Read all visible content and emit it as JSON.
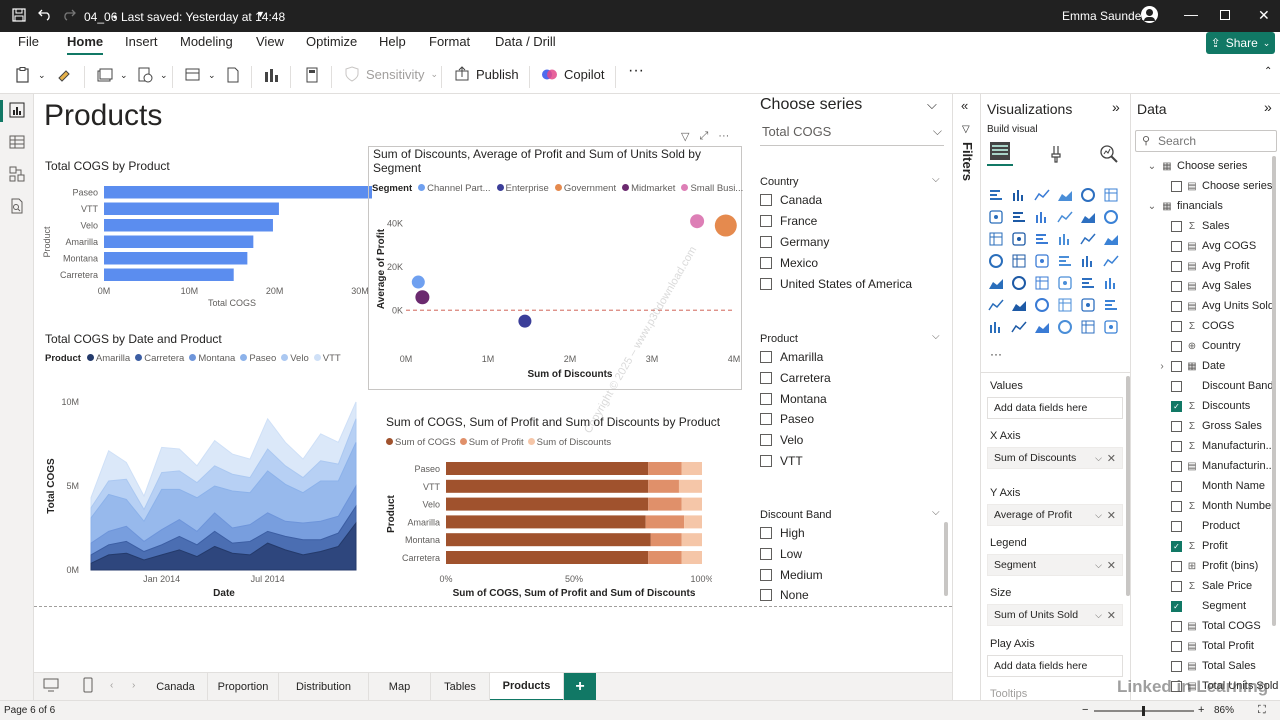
{
  "titlebar": {
    "file_name": "04_06",
    "saved": "Last saved: Yesterday at 14:48",
    "user": "Emma Saunders"
  },
  "ribbon": {
    "menus": [
      "File",
      "Home",
      "Insert",
      "Modeling",
      "View",
      "Optimize",
      "Help",
      "Format",
      "Data / Drill"
    ],
    "share": "Share",
    "sensitivity": "Sensitivity",
    "publish": "Publish",
    "copilot": "Copilot"
  },
  "page": {
    "title": "Products"
  },
  "charts": {
    "cogs_by_product": {
      "title": "Total COGS by Product",
      "chart_data": {
        "type": "bar",
        "categories": [
          "Paseo",
          "VTT",
          "Velo",
          "Amarilla",
          "Montana",
          "Carretera"
        ],
        "values": [
          33.0,
          20.5,
          19.8,
          17.5,
          16.8,
          15.2
        ],
        "xlabel": "Total COGS",
        "ylabel": "Product",
        "xticks": [
          "0M",
          "10M",
          "20M",
          "30M"
        ],
        "xlim": [
          0,
          30
        ]
      }
    },
    "scatter": {
      "title": "Sum of Discounts, Average of Profit and Sum of Units Sold by Segment",
      "legend_label": "Segment",
      "chart_data": {
        "type": "scatter",
        "series": [
          {
            "name": "Channel Part...",
            "x": 0.15,
            "y": 13000,
            "color": "#6fa0f0"
          },
          {
            "name": "Enterprise",
            "x": 1.45,
            "y": -5000,
            "color": "#3b3e99"
          },
          {
            "name": "Government",
            "x": 3.9,
            "y": 39000,
            "color": "#e58a4e"
          },
          {
            "name": "Midmarket",
            "x": 0.2,
            "y": 6000,
            "color": "#6b2a6f"
          },
          {
            "name": "Small Busi...",
            "x": 3.55,
            "y": 41000,
            "color": "#dd7fb6"
          }
        ],
        "xlabel": "Sum of Discounts",
        "ylabel": "Average of Profit",
        "xticks": [
          "0M",
          "1M",
          "2M",
          "3M",
          "4M"
        ],
        "yticks": [
          "0K",
          "20K",
          "40K"
        ],
        "xlim": [
          0,
          4
        ],
        "ylim": [
          -10000,
          48000
        ]
      }
    },
    "area": {
      "title": "Total COGS by Date and Product",
      "legend_label": "Product",
      "legend": [
        {
          "name": "Amarilla",
          "color": "#243a6b"
        },
        {
          "name": "Carretera",
          "color": "#3c5ea3"
        },
        {
          "name": "Montana",
          "color": "#6e95da"
        },
        {
          "name": "Paseo",
          "color": "#8cb2ea"
        },
        {
          "name": "Velo",
          "color": "#abc8f1"
        },
        {
          "name": "VTT",
          "color": "#cfe0f7"
        }
      ],
      "chart_data": {
        "type": "area",
        "x": [
          "Sep 2013",
          "Oct 2013",
          "Nov 2013",
          "Dec 2013",
          "Jan 2014",
          "Feb 2014",
          "Mar 2014",
          "Apr 2014",
          "May 2014",
          "Jun 2014",
          "Jul 2014",
          "Aug 2014",
          "Sep 2014",
          "Oct 2014",
          "Nov 2014",
          "Dec 2014"
        ],
        "series": [
          {
            "name": "Amarilla",
            "values": [
              0.4,
              0.9,
              1.0,
              0.6,
              0.9,
              1.2,
              0.8,
              1.4,
              1.0,
              0.9,
              1.6,
              1.2,
              0.9,
              1.1,
              1.4,
              2.8
            ]
          },
          {
            "name": "Carretera",
            "values": [
              0.5,
              0.6,
              0.7,
              0.5,
              0.6,
              0.8,
              0.7,
              0.9,
              0.6,
              0.8,
              0.7,
              0.8,
              0.9,
              0.7,
              0.8,
              1.0
            ]
          },
          {
            "name": "Montana",
            "values": [
              0.7,
              0.8,
              0.9,
              0.6,
              0.9,
              1.0,
              0.8,
              1.1,
              0.9,
              1.0,
              1.1,
              0.9,
              1.0,
              1.1,
              1.0,
              1.2
            ]
          },
          {
            "name": "Paseo",
            "values": [
              1.5,
              2.2,
              1.6,
              1.2,
              2.4,
              1.8,
              2.0,
              1.6,
              2.2,
              1.9,
              2.5,
              2.2,
              1.8,
              2.4,
              2.1,
              2.6
            ]
          },
          {
            "name": "Velo",
            "values": [
              0.6,
              0.8,
              1.2,
              0.7,
              1.0,
              1.1,
              0.9,
              1.2,
              1.0,
              0.9,
              1.3,
              1.1,
              0.9,
              1.2,
              1.0,
              1.4
            ]
          },
          {
            "name": "VTT",
            "values": [
              0.6,
              1.8,
              1.0,
              0.8,
              1.5,
              1.3,
              1.0,
              1.5,
              1.2,
              1.1,
              1.8,
              1.4,
              1.1,
              1.6,
              1.3,
              1.0
            ]
          }
        ],
        "xlabel": "Date",
        "ylabel": "Total COGS",
        "xticks": [
          "Jan 2014",
          "Jul 2014"
        ],
        "yticks": [
          "0M",
          "5M",
          "10M"
        ],
        "ylim": [
          0,
          10
        ]
      }
    },
    "stacked": {
      "title": "Sum of COGS, Sum of Profit and Sum of Discounts by Product",
      "legend": [
        {
          "name": "Sum of COGS",
          "color": "#a0522d"
        },
        {
          "name": "Sum of Profit",
          "color": "#e0906a"
        },
        {
          "name": "Sum of Discounts",
          "color": "#f5c6a8"
        }
      ],
      "chart_data": {
        "type": "bar",
        "stacked_100": true,
        "categories": [
          "Paseo",
          "VTT",
          "Velo",
          "Amarilla",
          "Montana",
          "Carretera"
        ],
        "series": [
          {
            "name": "Sum of COGS",
            "values": [
              79,
              79,
              79,
              78,
              80,
              79
            ]
          },
          {
            "name": "Sum of Profit",
            "values": [
              13,
              12,
              13,
              15,
              12,
              13
            ]
          },
          {
            "name": "Sum of Discounts",
            "values": [
              8,
              9,
              8,
              7,
              8,
              8
            ]
          }
        ],
        "xlabel": "Sum of COGS, Sum of Profit and Sum of Discounts",
        "ylabel": "Product",
        "xticks": [
          "0%",
          "50%",
          "100%"
        ]
      }
    }
  },
  "slicers": {
    "series_title": "Choose series",
    "series_value": "Total COGS",
    "country": {
      "header": "Country",
      "items": [
        "Canada",
        "France",
        "Germany",
        "Mexico",
        "United States of America"
      ]
    },
    "product": {
      "header": "Product",
      "items": [
        "Amarilla",
        "Carretera",
        "Montana",
        "Paseo",
        "Velo",
        "VTT"
      ]
    },
    "discount": {
      "header": "Discount Band",
      "items": [
        "High",
        "Low",
        "Medium",
        "None"
      ]
    }
  },
  "filters": {
    "label": "Filters"
  },
  "visualizations": {
    "title": "Visualizations",
    "build_label": "Build visual",
    "wells": [
      {
        "header": "Values",
        "value": "Add data fields here",
        "filled": false
      },
      {
        "header": "X Axis",
        "value": "Sum of Discounts",
        "filled": true
      },
      {
        "header": "Y Axis",
        "value": "Average of Profit",
        "filled": true
      },
      {
        "header": "Legend",
        "value": "Segment",
        "filled": true
      },
      {
        "header": "Size",
        "value": "Sum of Units Sold",
        "filled": true
      },
      {
        "header": "Play Axis",
        "value": "Add data fields here",
        "filled": false
      }
    ],
    "tooltips_header": "Tooltips"
  },
  "data_pane": {
    "title": "Data",
    "search_placeholder": "Search",
    "items": [
      {
        "label": "Choose series",
        "icon": "table",
        "indent": 0,
        "checked": false,
        "group": true
      },
      {
        "label": "Choose series",
        "icon": "table-field",
        "indent": 1,
        "checked": false
      },
      {
        "label": "financials",
        "icon": "table",
        "indent": 0,
        "checked": false,
        "group": true
      },
      {
        "label": "Sales",
        "icon": "sigma",
        "indent": 1,
        "checked": false
      },
      {
        "label": "Avg COGS",
        "icon": "calc",
        "indent": 1,
        "checked": false
      },
      {
        "label": "Avg Profit",
        "icon": "calc",
        "indent": 1,
        "checked": false
      },
      {
        "label": "Avg Sales",
        "icon": "calc",
        "indent": 1,
        "checked": false
      },
      {
        "label": "Avg Units Sold",
        "icon": "calc",
        "indent": 1,
        "checked": false
      },
      {
        "label": "COGS",
        "icon": "sigma",
        "indent": 1,
        "checked": false
      },
      {
        "label": "Country",
        "icon": "globe",
        "indent": 1,
        "checked": false
      },
      {
        "label": "Date",
        "icon": "calendar",
        "indent": 1,
        "checked": false,
        "expandable": true
      },
      {
        "label": "Discount Band",
        "icon": "",
        "indent": 1,
        "checked": false
      },
      {
        "label": "Discounts",
        "icon": "sigma",
        "indent": 1,
        "checked": true
      },
      {
        "label": "Gross Sales",
        "icon": "sigma",
        "indent": 1,
        "checked": false
      },
      {
        "label": "Manufacturin...",
        "icon": "sigma",
        "indent": 1,
        "checked": false
      },
      {
        "label": "Manufacturin...",
        "icon": "table-field",
        "indent": 1,
        "checked": false
      },
      {
        "label": "Month Name",
        "icon": "",
        "indent": 1,
        "checked": false
      },
      {
        "label": "Month Number",
        "icon": "sigma",
        "indent": 1,
        "checked": false
      },
      {
        "label": "Product",
        "icon": "",
        "indent": 1,
        "checked": false
      },
      {
        "label": "Profit",
        "icon": "sigma",
        "indent": 1,
        "checked": true
      },
      {
        "label": "Profit (bins)",
        "icon": "bins",
        "indent": 1,
        "checked": false
      },
      {
        "label": "Sale Price",
        "icon": "sigma",
        "indent": 1,
        "checked": false
      },
      {
        "label": "Segment",
        "icon": "",
        "indent": 1,
        "checked": true
      },
      {
        "label": "Total COGS",
        "icon": "calc",
        "indent": 1,
        "checked": false
      },
      {
        "label": "Total Profit",
        "icon": "calc",
        "indent": 1,
        "checked": false
      },
      {
        "label": "Total Sales",
        "icon": "calc",
        "indent": 1,
        "checked": false
      },
      {
        "label": "Total Units Sold",
        "icon": "calc",
        "indent": 1,
        "checked": false
      }
    ]
  },
  "tabs": {
    "items": [
      "Canada",
      "Proportion",
      "Distribution",
      "Map",
      "Tables",
      "Products"
    ],
    "active": "Products"
  },
  "status": {
    "page": "Page 6 of 6",
    "zoom": "86%"
  },
  "watermark": {
    "text": "Linked in Learning"
  },
  "accent": "#117865"
}
